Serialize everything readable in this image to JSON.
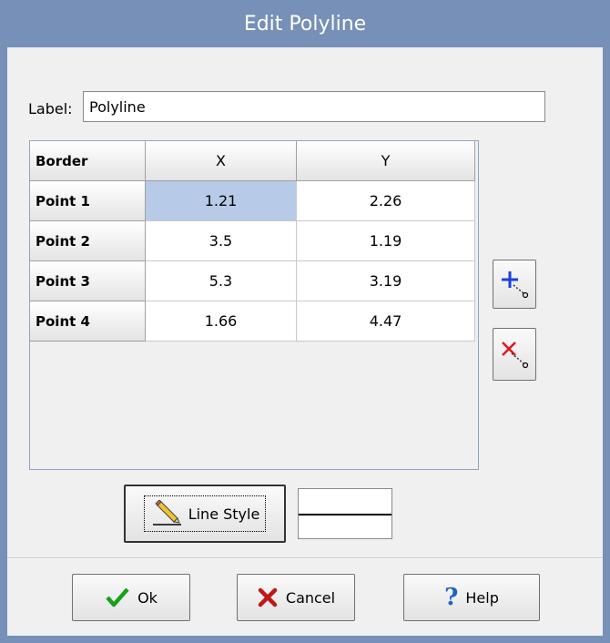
{
  "window": {
    "title": "Edit Polyline"
  },
  "label_field": {
    "label": "Label:",
    "value": "Polyline"
  },
  "grid": {
    "headers": [
      "Border",
      "X",
      "Y"
    ],
    "rows": [
      {
        "name": "Point 1",
        "x": "1.21",
        "y": "2.26"
      },
      {
        "name": "Point 2",
        "x": "3.5",
        "y": "1.19"
      },
      {
        "name": "Point 3",
        "x": "5.3",
        "y": "3.19"
      },
      {
        "name": "Point 4",
        "x": "1.66",
        "y": "4.47"
      }
    ],
    "selected_cell": "Point 1 X"
  },
  "side_buttons": {
    "add_icon": "add-point-icon",
    "delete_icon": "delete-point-icon"
  },
  "line_style": {
    "label": "Line Style",
    "icon": "pencil-icon",
    "preview_color": "#000000"
  },
  "footer": {
    "ok_label": "Ok",
    "cancel_label": "Cancel",
    "help_label": "Help"
  },
  "colors": {
    "title_bar": "#7690b7",
    "selection": "#b7cbe8",
    "ok_check": "#1aa11a",
    "cancel_x": "#c01818",
    "help_q": "#1c63c9",
    "add_plus": "#1a3ee8",
    "delete_x": "#e01818"
  }
}
